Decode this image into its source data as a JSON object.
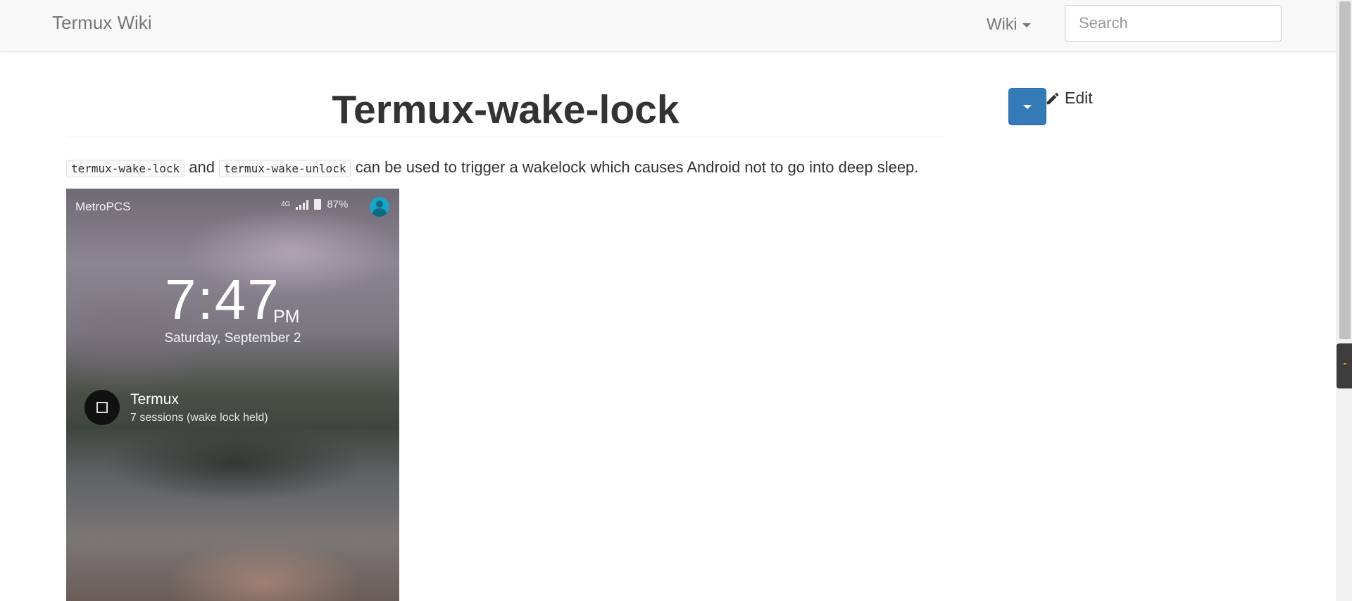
{
  "navbar": {
    "brand": "Termux Wiki",
    "wiki_menu": "Wiki",
    "search_placeholder": "Search"
  },
  "page": {
    "title": "Termux-wake-lock",
    "edit_label": "Edit",
    "paragraph": {
      "code1": "termux-wake-lock",
      "and": " and ",
      "code2": "termux-wake-unlock",
      "rest": " can be used to trigger a wakelock which causes Android not to go into deep sleep."
    }
  },
  "screenshot": {
    "carrier": "MetroPCS",
    "network": "4G",
    "battery": "87%",
    "time": "7:47",
    "ampm": "PM",
    "date": "Saturday, September 2",
    "notification_title": "Termux",
    "notification_text": "7 sessions (wake lock held)"
  },
  "colors": {
    "primary_button": "#337ab7",
    "navbar_bg": "#f8f8f8"
  },
  "icons": {
    "edit": "pencil-icon",
    "menu_toggle": "caret-down-icon"
  }
}
